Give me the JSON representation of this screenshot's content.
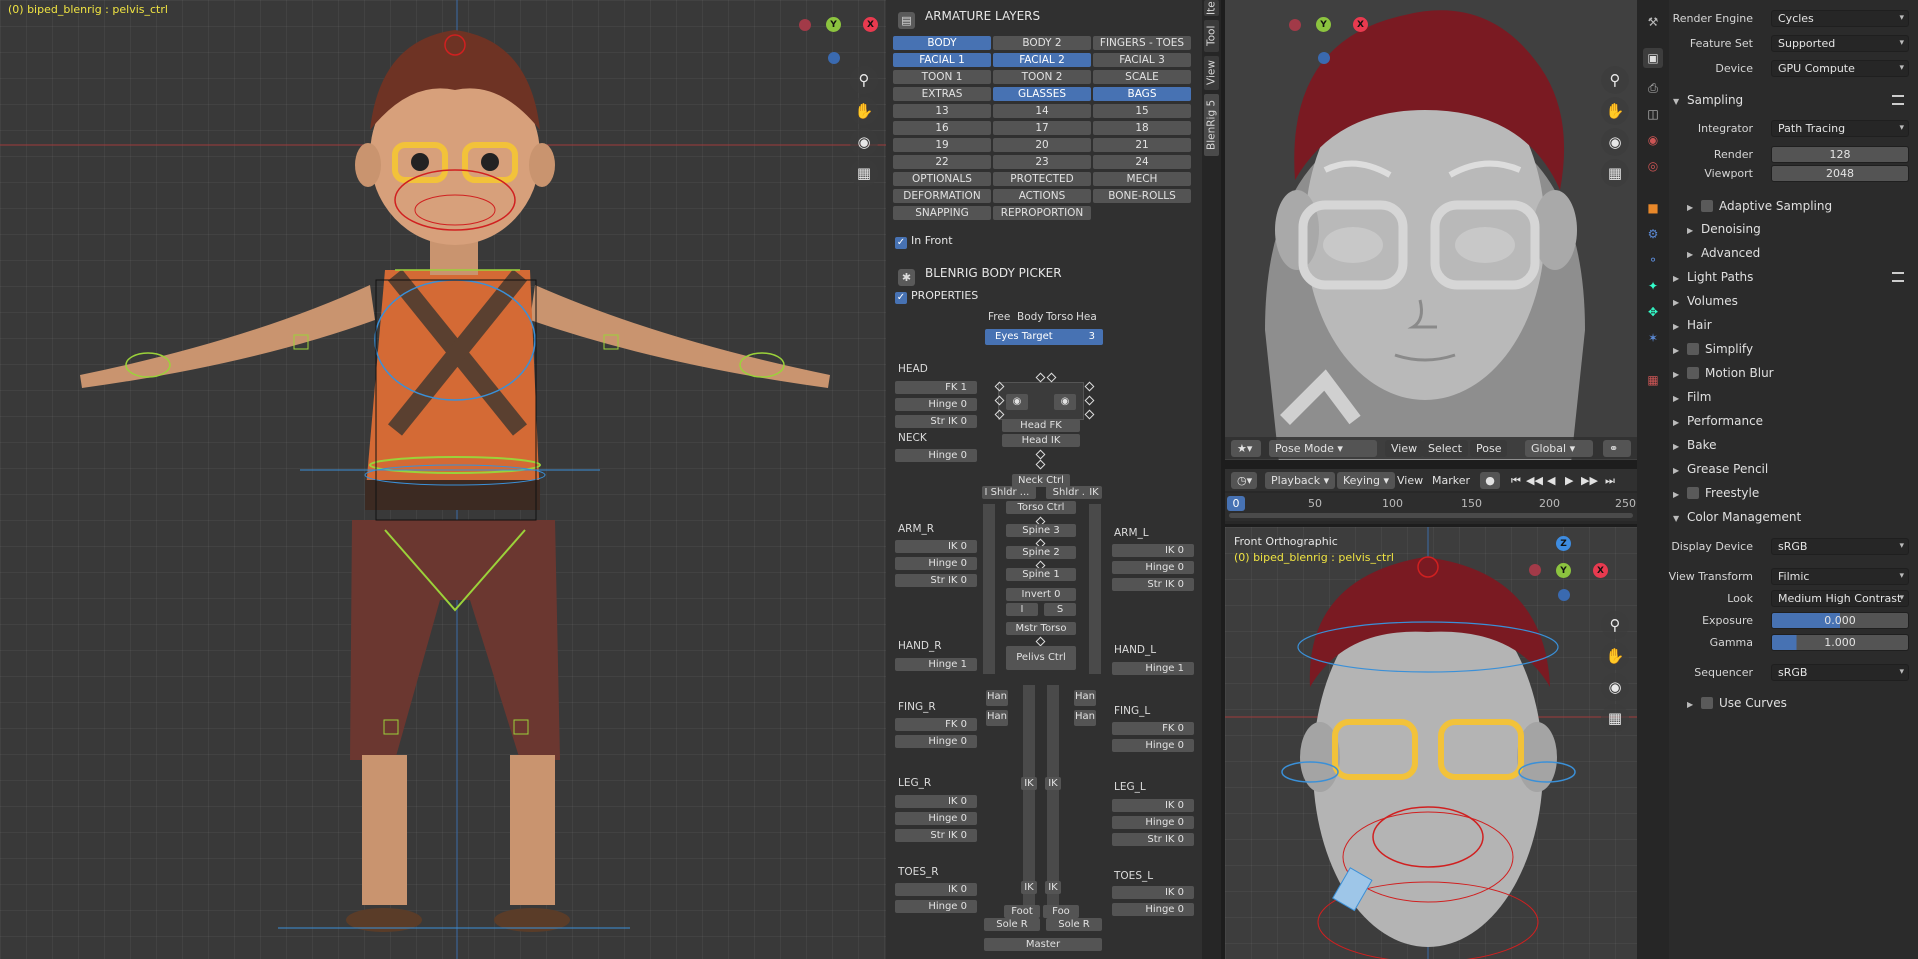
{
  "viewport_main": {
    "hud_text": "(0) biped_blenrig : pelvis_ctrl",
    "gizmo": {
      "y": "Y",
      "x": "X"
    }
  },
  "armature_layers": {
    "title": "ARMATURE LAYERS",
    "buttons": [
      {
        "label": "BODY",
        "on": true
      },
      {
        "label": "BODY 2",
        "on": false
      },
      {
        "label": "FINGERS - TOES",
        "on": false
      },
      {
        "label": "FACIAL 1",
        "on": true
      },
      {
        "label": "FACIAL 2",
        "on": true
      },
      {
        "label": "FACIAL 3",
        "on": false
      },
      {
        "label": "TOON 1",
        "on": false
      },
      {
        "label": "TOON 2",
        "on": false
      },
      {
        "label": "SCALE",
        "on": false
      },
      {
        "label": "EXTRAS",
        "on": false
      },
      {
        "label": "GLASSES",
        "on": true
      },
      {
        "label": "BAGS",
        "on": true
      },
      {
        "label": "13",
        "on": false
      },
      {
        "label": "14",
        "on": false
      },
      {
        "label": "15",
        "on": false
      },
      {
        "label": "16",
        "on": false
      },
      {
        "label": "17",
        "on": false
      },
      {
        "label": "18",
        "on": false
      },
      {
        "label": "19",
        "on": false
      },
      {
        "label": "20",
        "on": false
      },
      {
        "label": "21",
        "on": false
      },
      {
        "label": "22",
        "on": false
      },
      {
        "label": "23",
        "on": false
      },
      {
        "label": "24",
        "on": false
      },
      {
        "label": "OPTIONALS",
        "on": false
      },
      {
        "label": "PROTECTED",
        "on": false
      },
      {
        "label": "MECH",
        "on": false
      },
      {
        "label": "DEFORMATION",
        "on": false
      },
      {
        "label": "ACTIONS",
        "on": false
      },
      {
        "label": "BONE-ROLLS",
        "on": false
      },
      {
        "label": "SNAPPING",
        "on": false
      },
      {
        "label": "REPROPORTION",
        "on": false
      }
    ],
    "in_front": "In Front"
  },
  "body_picker": {
    "title": "BLENRIG BODY PICKER",
    "properties": "PROPERTIES",
    "tabs": [
      "Free",
      "Body",
      "Torso",
      "Hea"
    ],
    "eyes_target": {
      "label": "Eyes Target",
      "value": "3"
    },
    "head": {
      "label": "HEAD",
      "fk": "FK 1",
      "hinge": "Hinge 0",
      "str_ik": "Str IK 0"
    },
    "neck": {
      "label": "NECK",
      "hinge": "Hinge 0"
    },
    "arm_r": {
      "label": "ARM_R",
      "ik": "IK 0",
      "hinge": "Hinge 0",
      "str_ik": "Str IK 0"
    },
    "arm_l": {
      "label": "ARM_L",
      "ik": "IK 0",
      "hinge": "Hinge 0",
      "str_ik": "Str IK 0"
    },
    "hand_r": {
      "label": "HAND_R",
      "hinge": "Hinge 1"
    },
    "hand_l": {
      "label": "HAND_L",
      "hinge": "Hinge 1"
    },
    "fing_r": {
      "label": "FING_R",
      "fk": "FK 0",
      "hinge": "Hinge 0"
    },
    "fing_l": {
      "label": "FING_L",
      "fk": "FK 0",
      "hinge": "Hinge 0"
    },
    "leg_r": {
      "label": "LEG_R",
      "ik": "IK 0",
      "hinge": "Hinge 0",
      "str_ik": "Str IK 0"
    },
    "leg_l": {
      "label": "LEG_L",
      "ik": "IK 0",
      "hinge": "Hinge 0",
      "str_ik": "Str IK 0"
    },
    "toes_r": {
      "label": "TOES_R",
      "ik": "IK 0",
      "hinge": "Hinge 0"
    },
    "toes_l": {
      "label": "TOES_L",
      "ik": "IK 0",
      "hinge": "Hinge 0"
    },
    "center": {
      "head_fk": "Head FK",
      "head_ik": "Head IK",
      "neck_ctrl": "Neck Ctrl",
      "shldr_r": "Shldr ...",
      "shldr_l": "Shldr ...",
      "torso_ctrl": "Torso Ctrl",
      "spine3": "Spine 3",
      "spine2": "Spine 2",
      "spine1": "Spine 1",
      "invert": "Invert 0",
      "i": "I",
      "s": "S",
      "mstr_torso": "Mstr Torso",
      "pelvis_ctrl": "Pelivs Ctrl",
      "han1": "Han",
      "han2": "Han",
      "han3": "Han",
      "han4": "Han",
      "foot_r": "Foot",
      "foot_l": "Foo",
      "sole_r": "Sole R",
      "sole_l": "Sole R",
      "master": "Master",
      "ik_small": "IK",
      "f_small": "F",
      "i_small": "I"
    }
  },
  "side_tabs": [
    "Ite",
    "Tool",
    "View",
    "BlenRig 5"
  ],
  "viewport_persp": {
    "mode": "Pose Mode",
    "view": "View",
    "select": "Select",
    "pose": "Pose",
    "orientation": "Global",
    "gizmo": {
      "y": "Y",
      "x": "X"
    }
  },
  "timeline": {
    "playback": "Playback",
    "keying": "Keying",
    "view": "View",
    "marker": "Marker",
    "current_frame": "0",
    "ticks": [
      "50",
      "100",
      "150",
      "200",
      "250"
    ]
  },
  "viewport_ortho": {
    "title": "Front Orthographic",
    "hud_text": "(0) biped_blenrig : pelvis_ctrl",
    "gizmo": {
      "z": "Z",
      "y": "Y",
      "x": "X"
    }
  },
  "render_props": {
    "render_engine": {
      "label": "Render Engine",
      "value": "Cycles"
    },
    "feature_set": {
      "label": "Feature Set",
      "value": "Supported"
    },
    "device": {
      "label": "Device",
      "value": "GPU Compute"
    },
    "sampling": "Sampling",
    "integrator": {
      "label": "Integrator",
      "value": "Path Tracing"
    },
    "render": {
      "label": "Render",
      "value": "128"
    },
    "viewport": {
      "label": "Viewport",
      "value": "2048"
    },
    "adaptive": "Adaptive Sampling",
    "denoising": "Denoising",
    "advanced": "Advanced",
    "sections": [
      "Light Paths",
      "Volumes",
      "Hair",
      "Simplify",
      "Motion Blur",
      "Film",
      "Performance",
      "Bake",
      "Grease Pencil",
      "Freestyle"
    ],
    "color_management": "Color Management",
    "display_device": {
      "label": "Display Device",
      "value": "sRGB"
    },
    "view_transform": {
      "label": "View Transform",
      "value": "Filmic"
    },
    "look": {
      "label": "Look",
      "value": "Medium High Contrast"
    },
    "exposure": {
      "label": "Exposure",
      "value": "0.000"
    },
    "gamma": {
      "label": "Gamma",
      "value": "1.000"
    },
    "sequencer": {
      "label": "Sequencer",
      "value": "sRGB"
    },
    "use_curves": "Use Curves"
  },
  "colors": {
    "accent": "#4772b3",
    "hud_yellow": "#f0e442",
    "axis_x": "#e83a4f",
    "axis_y": "#8cc43f",
    "axis_z": "#3e8ce0"
  }
}
